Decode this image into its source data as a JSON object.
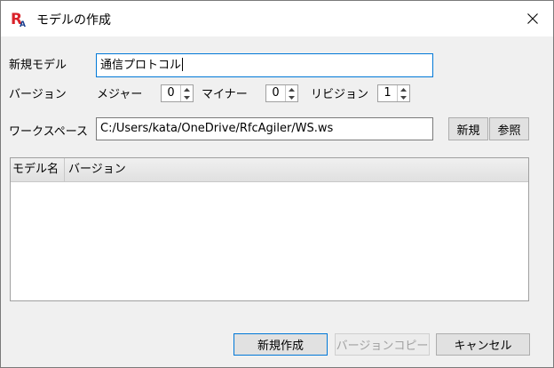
{
  "window": {
    "title": "モデルの作成",
    "app_icon_text": "RA",
    "brand_color": "#d9222a"
  },
  "form": {
    "model_label": "新規モデル",
    "model_value": "通信プロトコル",
    "version_label": "バージョン",
    "major_label": "メジャー",
    "major_value": "0",
    "minor_label": "マイナー",
    "minor_value": "0",
    "revision_label": "リビジョン",
    "revision_value": "1",
    "workspace_label": "ワークスペース",
    "workspace_value": "C:/Users/kata/OneDrive/RfcAgiler/WS.ws",
    "new_label": "新規",
    "browse_label": "参照"
  },
  "table": {
    "columns": [
      "モデル名",
      "バージョン"
    ],
    "rows": []
  },
  "footer": {
    "create_label": "新規作成",
    "copy_version_label": "バージョンコピー",
    "cancel_label": "キャンセル"
  }
}
